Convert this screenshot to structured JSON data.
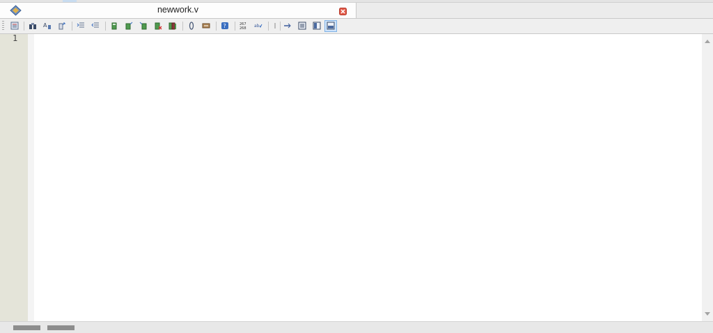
{
  "tab": {
    "title": "newwork.v",
    "icon": "verilog-file-icon",
    "close_icon": "close-tab-icon",
    "close_color": "#e25b4a"
  },
  "toolbar": {
    "buttons": [
      "show-symbols-icon",
      "find-icon",
      "replace-icon",
      "goto-icon",
      "indent-icon",
      "outdent-icon",
      "bookmark-toggle-icon",
      "bookmark-next-icon",
      "bookmark-prev-icon",
      "bookmark-clear-icon",
      "bookmark-list-icon",
      "attach-icon",
      "script-icon",
      "help-icon",
      "line-numbers-icon",
      "spell-check-icon",
      "wrap-icon",
      "align-left-icon",
      "split-icon",
      "layout-icon"
    ],
    "active_button": "layout-icon",
    "active_color": "#cfe4fb"
  },
  "editor": {
    "line_numbers": [
      "1"
    ],
    "content": ""
  }
}
